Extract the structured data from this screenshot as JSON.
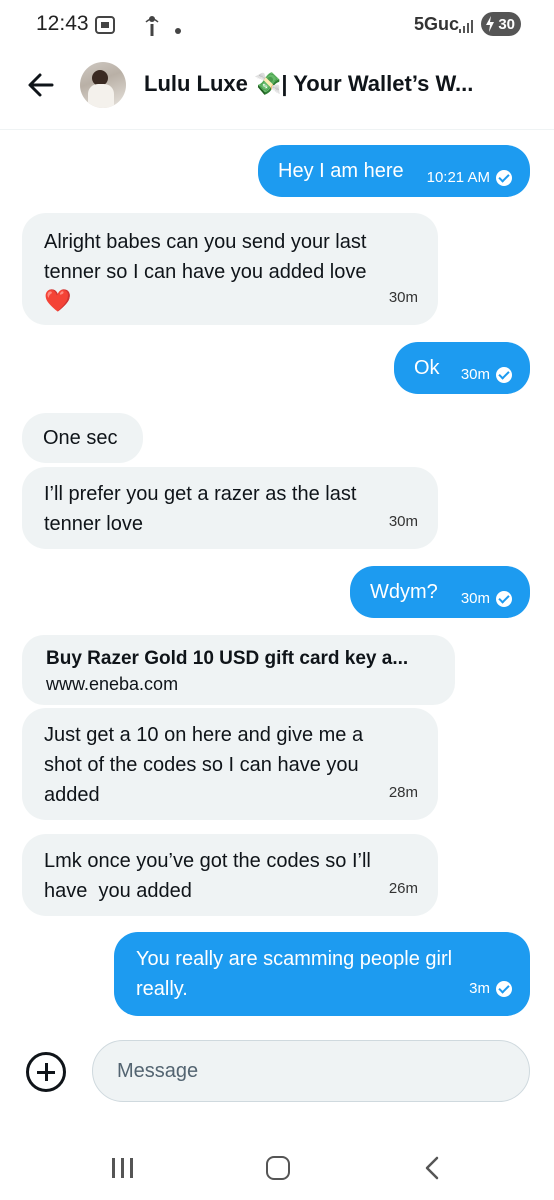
{
  "status_bar": {
    "time": "12:43",
    "network": "5Guc",
    "battery": "30"
  },
  "header": {
    "title": "Lulu Luxe 💸| Your Wallet’s W..."
  },
  "messages": [
    {
      "direction": "out",
      "text": "Hey I am here",
      "time": "10:21 AM"
    },
    {
      "direction": "in",
      "text": "Alright babes can you send your last tenner so I can have you added love",
      "emoji": "❤️",
      "time": "30m"
    },
    {
      "direction": "out",
      "text": "Ok",
      "time": "30m"
    },
    {
      "direction": "in",
      "text": "One sec"
    },
    {
      "direction": "in",
      "text": "I’ll prefer you get a razer as the last tenner love",
      "time": "30m"
    },
    {
      "direction": "out",
      "text": "Wdym?",
      "time": "30m"
    },
    {
      "direction": "in",
      "type": "link",
      "title": "Buy Razer Gold 10 USD gift card key a...",
      "url": "www.eneba.com"
    },
    {
      "direction": "in",
      "text": "Just get a 10 on here and give me a shot of the codes so I can have you added",
      "time": "28m"
    },
    {
      "direction": "in",
      "text": "Lmk once you’ve got the codes so I’ll have  you added",
      "time": "26m"
    },
    {
      "direction": "out",
      "text": "You really are scamming people girl really.",
      "time": "3m"
    }
  ],
  "composer": {
    "placeholder": "Message"
  },
  "colors": {
    "outgoing_bubble": "#1d9bf0",
    "incoming_bubble": "#eff3f4"
  }
}
